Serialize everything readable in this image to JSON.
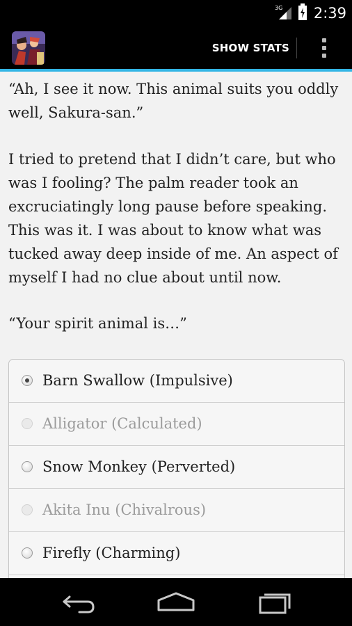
{
  "status_bar": {
    "network_label": "3G",
    "time": "2:39"
  },
  "action_bar": {
    "app_icon": "story-cover-icon",
    "show_stats_label": "SHOW STATS",
    "overflow_icon": "overflow-menu-icon",
    "accent_color": "#33b5e5"
  },
  "story": {
    "paragraphs": [
      "“Ah, I see it now. This animal suits you oddly well, Sakura-san.”",
      "I tried to pretend that I didn’t care, but who was I fooling? The palm reader took an excruciatingly long pause before speaking. This was it. I was about to know what was tucked away deep inside of me. An aspect of myself I had no clue about until now.",
      "“Your spirit animal is…”"
    ]
  },
  "choices": [
    {
      "label": "Barn Swallow (Impulsive)",
      "selected": true,
      "enabled": true
    },
    {
      "label": "Alligator (Calculated)",
      "selected": false,
      "enabled": false
    },
    {
      "label": "Snow Monkey (Perverted)",
      "selected": false,
      "enabled": true
    },
    {
      "label": "Akita Inu (Chivalrous)",
      "selected": false,
      "enabled": false
    },
    {
      "label": "Firefly (Charming)",
      "selected": false,
      "enabled": true
    }
  ],
  "nav_bar": {
    "back_icon": "back-icon",
    "home_icon": "home-icon",
    "recents_icon": "recent-apps-icon"
  }
}
